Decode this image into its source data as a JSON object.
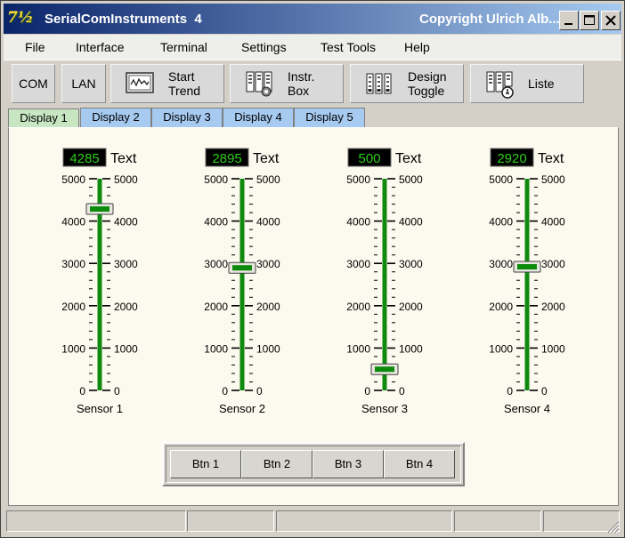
{
  "window": {
    "app_name": "SerialComInstruments  4",
    "copyright": "Copyright Ulrich Alb...",
    "icon_text": "7½"
  },
  "menu": [
    "File",
    "Interface",
    "Terminal",
    "Settings",
    "Test Tools",
    "Help"
  ],
  "toolbar": {
    "com": "COM",
    "lan": "LAN",
    "start_trend": [
      "Start",
      "Trend"
    ],
    "instr_box": [
      "Instr.",
      "Box"
    ],
    "design_toggle": [
      "Design",
      "Toggle"
    ],
    "liste": "Liste"
  },
  "tabs": [
    "Display 1",
    "Display 2",
    "Display 3",
    "Display 4",
    "Display 5"
  ],
  "active_tab": 0,
  "scale": {
    "min": 0,
    "max": 5000,
    "labels": [
      "5000",
      "4000",
      "3000",
      "2000",
      "1000",
      "0"
    ]
  },
  "sensors": [
    {
      "name": "Sensor 1",
      "value": 4285,
      "display": "4285",
      "unit_label": "Text"
    },
    {
      "name": "Sensor 2",
      "value": 2895,
      "display": "2895",
      "unit_label": "Text"
    },
    {
      "name": "Sensor 3",
      "value": 500,
      "display": "500",
      "unit_label": "Text"
    },
    {
      "name": "Sensor 4",
      "value": 2920,
      "display": "2920",
      "unit_label": "Text"
    }
  ],
  "buttons": [
    "Btn 1",
    "Btn 2",
    "Btn 3",
    "Btn 4"
  ],
  "colors": {
    "display_bg": "#000000",
    "display_text": "#2ecc1a",
    "slider_track": "#0f8a0f",
    "thumb": "#0b8a0b",
    "tab_active": "#c7e6c1",
    "tab_inactive": "#a6caf0",
    "panel_bg": "#fcf9ee"
  }
}
